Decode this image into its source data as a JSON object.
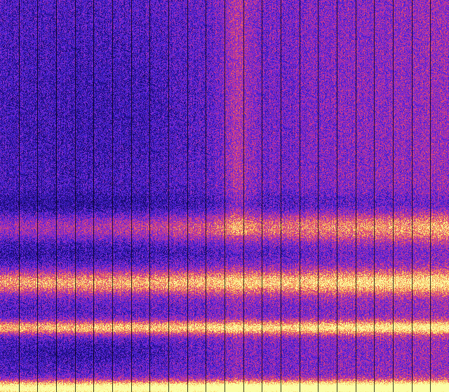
{
  "image": {
    "kind": "spectrogram-waterfall",
    "colormap": [
      "#1a0a6e",
      "#3a1fd0",
      "#7a2ad8",
      "#c0309a",
      "#f0605a",
      "#f8c860",
      "#fbfda6"
    ],
    "divider_color": "#000000",
    "divider_count": 24,
    "bright_bands": [
      {
        "name": "upper-band",
        "level": 0.55
      },
      {
        "name": "middle-band",
        "level": 0.72
      },
      {
        "name": "lower-band",
        "level": 0.83
      },
      {
        "name": "bottom-band",
        "level": 0.97
      }
    ]
  }
}
